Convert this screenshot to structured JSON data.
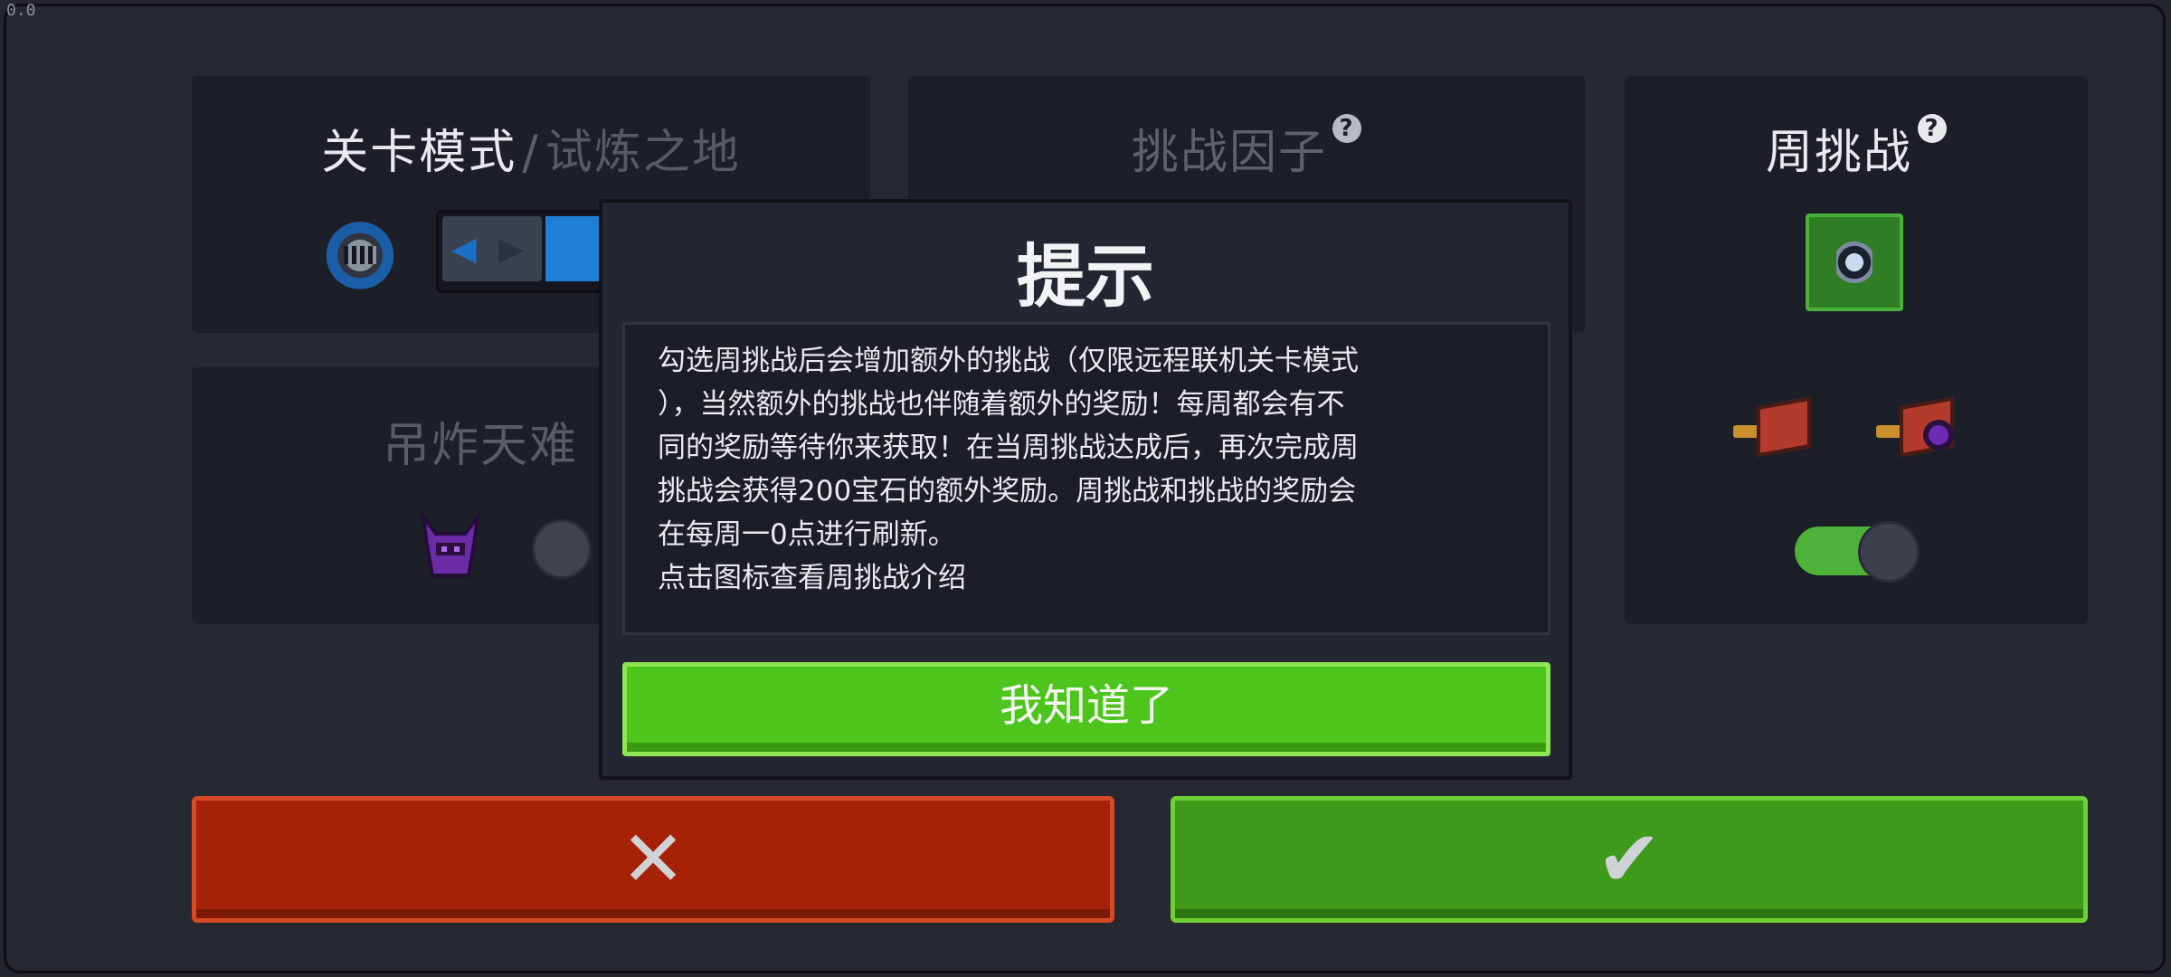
{
  "version": "0.0",
  "mode_panel": {
    "title_main": "关卡模式",
    "separator": "/",
    "title_sub": "试炼之地"
  },
  "factor_panel": {
    "title": "挑战因子",
    "help": "?"
  },
  "bomb_panel": {
    "title": "吊炸天难"
  },
  "weekly_panel": {
    "title": "周挑战",
    "help": "?",
    "toggle_state": "on"
  },
  "dialog": {
    "title": "提示",
    "lines": [
      "勾选周挑战后会增加额外的挑战（仅限远程联机关卡模式",
      "），当然额外的挑战也伴随着额外的奖励！每周都会有不",
      "同的奖励等待你来获取！在当周挑战达成后，再次完成周",
      "挑战会获得200宝石的额外奖励。周挑战和挑战的奖励会",
      "在每周一0点进行刷新。",
      "点击图标查看周挑战介绍"
    ],
    "ok_label": "我知道了"
  },
  "buttons": {
    "cancel_glyph": "✕",
    "confirm_glyph": "✔"
  },
  "colors": {
    "cancel": "#a52208",
    "confirm": "#3f991b",
    "ok_button": "#4ec51c",
    "slider": "#1f7fd6"
  },
  "icons": {
    "mode": "knight-helmet-icon",
    "bomb": "demon-helmet-icon",
    "weekly": "weekly-challenge-icon",
    "reward1": "chest-key-icon",
    "reward2": "chest-orb-icon"
  }
}
